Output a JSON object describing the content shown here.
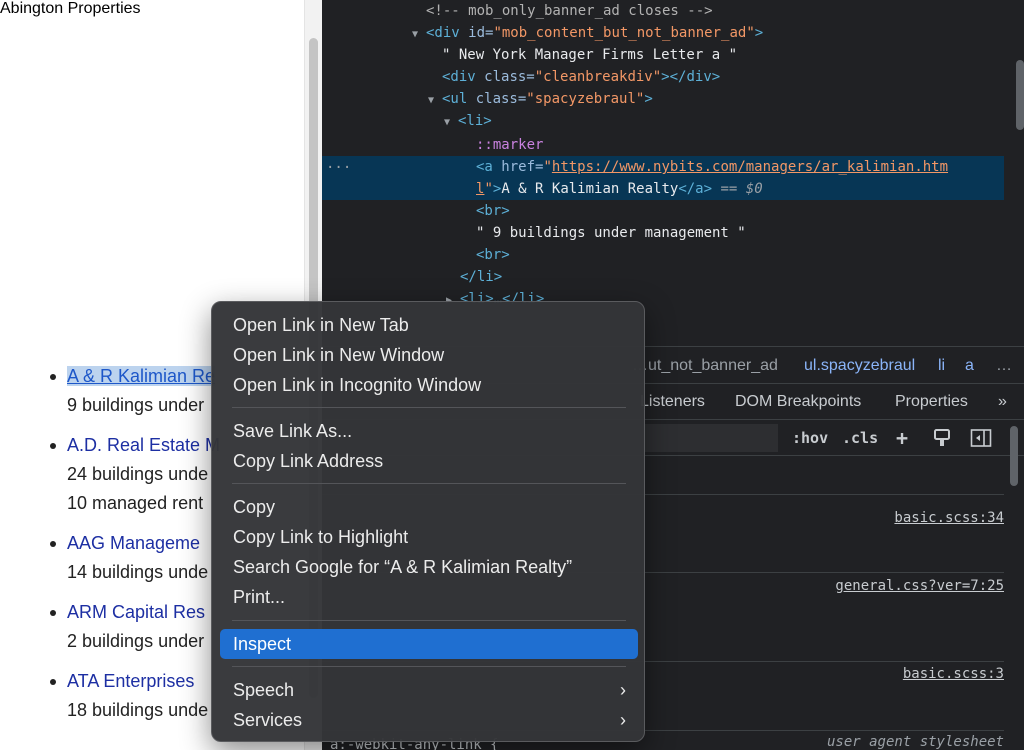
{
  "page": {
    "items": [
      {
        "name": "A & R Kalimian Re",
        "lines": [
          "9 buildings under"
        ]
      },
      {
        "name": "A.D. Real Estate M",
        "lines": [
          "24 buildings unde",
          "10 managed rent"
        ]
      },
      {
        "name": "AAG Manageme",
        "lines": [
          "14 buildings unde"
        ]
      },
      {
        "name": "ARM Capital Res",
        "lines": [
          "2 buildings under"
        ]
      },
      {
        "name": "ATA Enterprises",
        "lines": [
          "18 buildings unde"
        ]
      }
    ],
    "cut_item": "Abington Properties"
  },
  "devtools": {
    "tree": {
      "l0_comment": "<!-- mob_only_banner_ad closes -->",
      "l1_tag_open": "<div ",
      "l1_attr": "id=",
      "l1_val": "\"mob_content_but_not_banner_ad\"",
      "l1_close": ">",
      "l2_text": "\" New York Manager Firms Letter a \"",
      "l3_tag_open": "<div ",
      "l3_attr": "class=",
      "l3_val": "\"cleanbreakdiv\"",
      "l3_close": "></div>",
      "l4_tag_open": "<ul ",
      "l4_attr": "class=",
      "l4_val": "\"spacyzebraul\"",
      "l4_close": ">",
      "l5_tag": "<li>",
      "l6_pseudo": "::marker",
      "l7_tag_open": "<a ",
      "l7_attr": "href=",
      "l7_q": "\"",
      "l7_link": "https://www.nybits.com/managers/ar_kalimian.htm",
      "l8_link": "l",
      "l8_q": "\"",
      "l8_gt": ">",
      "l8_text": "A & R Kalimian Realty",
      "l8_close": "</a>",
      "l8_eq": " == $0",
      "l9_tag": "<br>",
      "l10_text": "\" 9 buildings under management \"",
      "l11_tag": "<br>",
      "l12_tag": "</li>",
      "l13_tag": "<li>…</li>",
      "dots": "···"
    },
    "breadcrumbs": [
      "…ut_not_banner_ad",
      "ul.spacyzebraul",
      "li",
      "a",
      "…"
    ],
    "subtabs": [
      "Listeners",
      "DOM Breakpoints",
      "Properties",
      "»"
    ],
    "filter_buttons": [
      ":hov",
      ".cls",
      "+"
    ],
    "sources": [
      "basic.scss:34",
      "general.css?ver=7:25",
      "basic.scss:3"
    ],
    "user_agent": "user agent stylesheet",
    "bottom_selector": "a:-webkit-any-link {"
  },
  "menu": {
    "items": [
      "Open Link in New Tab",
      "Open Link in New Window",
      "Open Link in Incognito Window",
      "Save Link As...",
      "Copy Link Address",
      "Copy",
      "Copy Link to Highlight",
      "Search Google for “A & R Kalimian Realty”",
      "Print...",
      "Inspect",
      "Speech",
      "Services"
    ],
    "arrow": "›"
  },
  "colors": {
    "menu_active": "#1f6fd1",
    "selected_node": "#073655",
    "devtools_bg": "#202124"
  }
}
